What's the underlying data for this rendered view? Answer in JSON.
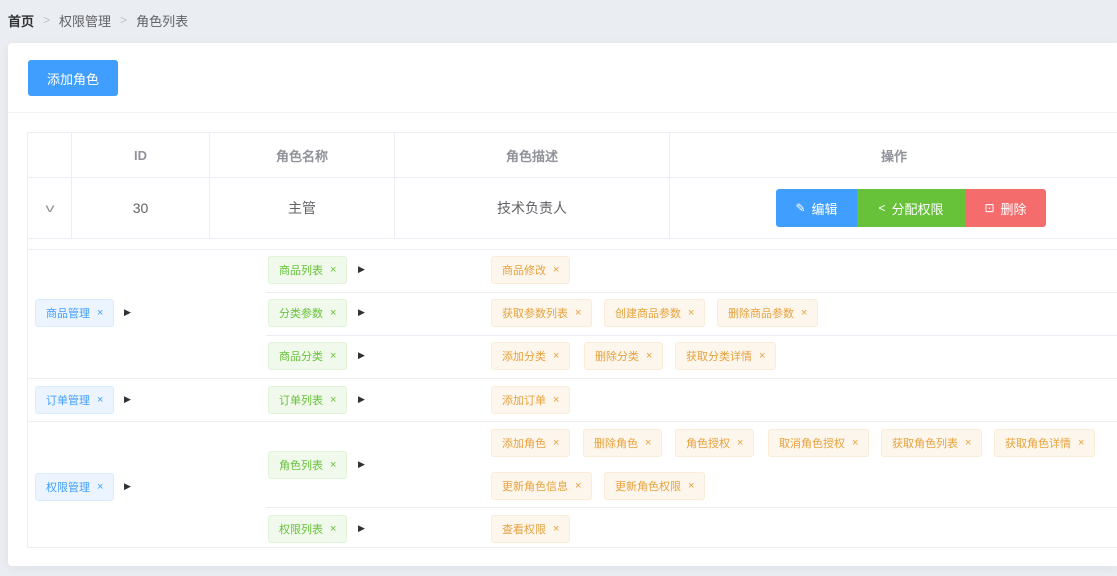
{
  "breadcrumb": {
    "home": "首页",
    "section": "权限管理",
    "current": "角色列表"
  },
  "toolbar": {
    "add_role_label": "添加角色"
  },
  "table": {
    "columns": {
      "id": "ID",
      "name": "角色名称",
      "desc": "角色描述",
      "ops": "操作"
    },
    "row": {
      "id": "30",
      "name": "主管",
      "desc": "技术负责人"
    },
    "actions": {
      "edit": "编辑",
      "assign": "分配权限",
      "delete": "删除"
    }
  },
  "close_glyph": "×",
  "icons": [
    "chevron-down-icon",
    "edit-icon",
    "share-icon",
    "delete-icon",
    "close-icon",
    "caret-right-icon"
  ],
  "colors": {
    "primary": "#409eff",
    "success": "#67c23a",
    "danger": "#f56c6c",
    "warning": "#e6a23c"
  },
  "rights": [
    {
      "name": "商品管理",
      "children": [
        {
          "name": "商品列表",
          "children": [
            "商品修改"
          ]
        },
        {
          "name": "分类参数",
          "children": [
            "获取参数列表",
            "创建商品参数",
            "删除商品参数"
          ]
        },
        {
          "name": "商品分类",
          "children": [
            "添加分类",
            "删除分类",
            "获取分类详情"
          ]
        }
      ]
    },
    {
      "name": "订单管理",
      "children": [
        {
          "name": "订单列表",
          "children": [
            "添加订单"
          ]
        }
      ]
    },
    {
      "name": "权限管理",
      "children": [
        {
          "name": "角色列表",
          "children": [
            "添加角色",
            "删除角色",
            "角色授权",
            "取消角色授权",
            "获取角色列表",
            "获取角色详情",
            "更新角色信息",
            "更新角色权限"
          ]
        },
        {
          "name": "权限列表",
          "children": [
            "查看权限"
          ]
        }
      ]
    }
  ]
}
